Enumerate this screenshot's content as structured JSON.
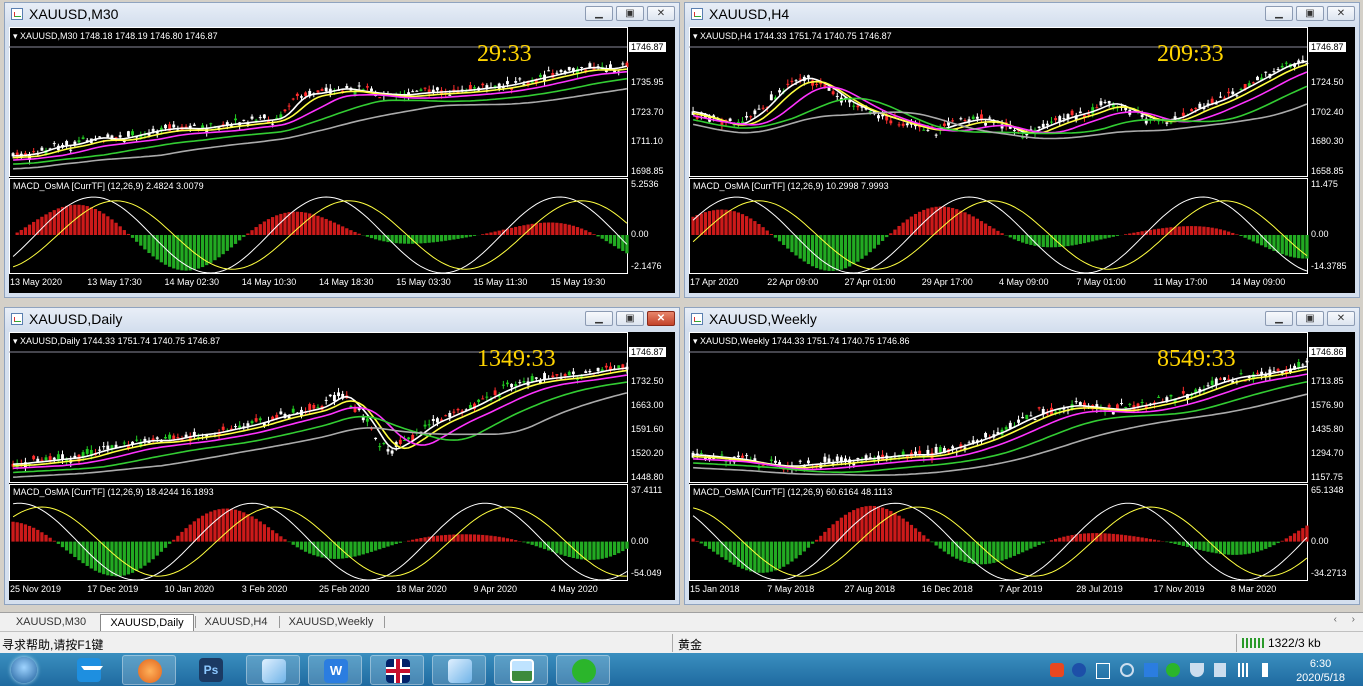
{
  "windows": [
    {
      "id": "m30",
      "title": "XAUUSD,M30",
      "header": "XAUUSD,M30  1748.18 1748.19 1746.80 1746.87",
      "timer": "29:33",
      "price_ticks": [
        "1746.87",
        "1735.95",
        "1723.70",
        "1711.10",
        "1698.85"
      ],
      "macd_header": "MACD_OsMA [CurrTF] (12,26,9) 2.4824 3.0079",
      "macd_ticks": [
        "5.2536",
        "0.00",
        "-2.1476"
      ],
      "date_ticks": [
        "13 May 2020",
        "13 May 17:30",
        "14 May 02:30",
        "14 May 10:30",
        "14 May 18:30",
        "15 May 03:30",
        "15 May 11:30",
        "15 May 19:30"
      ]
    },
    {
      "id": "h4",
      "title": "XAUUSD,H4",
      "header": "XAUUSD,H4  1744.33 1751.74 1740.75 1746.87",
      "timer": "209:33",
      "price_ticks": [
        "1746.87",
        "1724.50",
        "1702.40",
        "1680.30",
        "1658.85"
      ],
      "macd_header": "MACD_OsMA [CurrTF] (12,26,9) 10.2998 7.9993",
      "macd_ticks": [
        "11.475",
        "0.00",
        "-14.3785"
      ],
      "date_ticks": [
        "17 Apr 2020",
        "22 Apr 09:00",
        "27 Apr 01:00",
        "29 Apr 17:00",
        "4 May 09:00",
        "7 May 01:00",
        "11 May 17:00",
        "14 May 09:00"
      ]
    },
    {
      "id": "daily",
      "title": "XAUUSD,Daily",
      "header": "XAUUSD,Daily  1744.33 1751.74 1740.75 1746.87",
      "timer": "1349:33",
      "price_ticks": [
        "1746.87",
        "1732.50",
        "1663.00",
        "1591.60",
        "1520.20",
        "1448.80"
      ],
      "macd_header": "MACD_OsMA [CurrTF] (12,26,9) 18.4244 16.1893",
      "macd_ticks": [
        "37.4111",
        "0.00",
        "-54.049"
      ],
      "date_ticks": [
        "25 Nov 2019",
        "17 Dec 2019",
        "10 Jan 2020",
        "3 Feb 2020",
        "25 Feb 2020",
        "18 Mar 2020",
        "9 Apr 2020",
        "4 May 2020"
      ]
    },
    {
      "id": "weekly",
      "title": "XAUUSD,Weekly",
      "header": "XAUUSD,Weekly  1744.33 1751.74 1740.75 1746.86",
      "timer": "8549:33",
      "price_ticks": [
        "1746.86",
        "1713.85",
        "1576.90",
        "1435.80",
        "1294.70",
        "1157.75"
      ],
      "macd_header": "MACD_OsMA [CurrTF] (12,26,9) 60.6164 48.1113",
      "macd_ticks": [
        "65.1348",
        "0.00",
        "-34.2713"
      ],
      "date_ticks": [
        "15 Jan 2018",
        "7 May 2018",
        "27 Aug 2018",
        "16 Dec 2018",
        "7 Apr 2019",
        "28 Jul 2019",
        "17 Nov 2019",
        "8 Mar 2020"
      ]
    }
  ],
  "tabs": [
    "XAUUSD,M30",
    "XAUUSD,Daily",
    "XAUUSD,H4",
    "XAUUSD,Weekly"
  ],
  "active_tab": "XAUUSD,Daily",
  "status": {
    "help": "寻求帮助,请按F1键",
    "symbol": "黄金",
    "traffic": "1322/3 kb"
  },
  "clock": {
    "time": "6:30",
    "date": "2020/5/18"
  },
  "colors": {
    "bull": "#ffffff",
    "bear": "#ff2d2d",
    "ma_white": "#ffffff",
    "ma_yellow": "#ffff40",
    "ma_magenta": "#ff33ff",
    "ma_green": "#33cc33",
    "ma_gray": "#aaaaaa",
    "hist_pos": "#cc1a1a",
    "hist_neg": "#22aa22",
    "timer": "#ffd400"
  }
}
